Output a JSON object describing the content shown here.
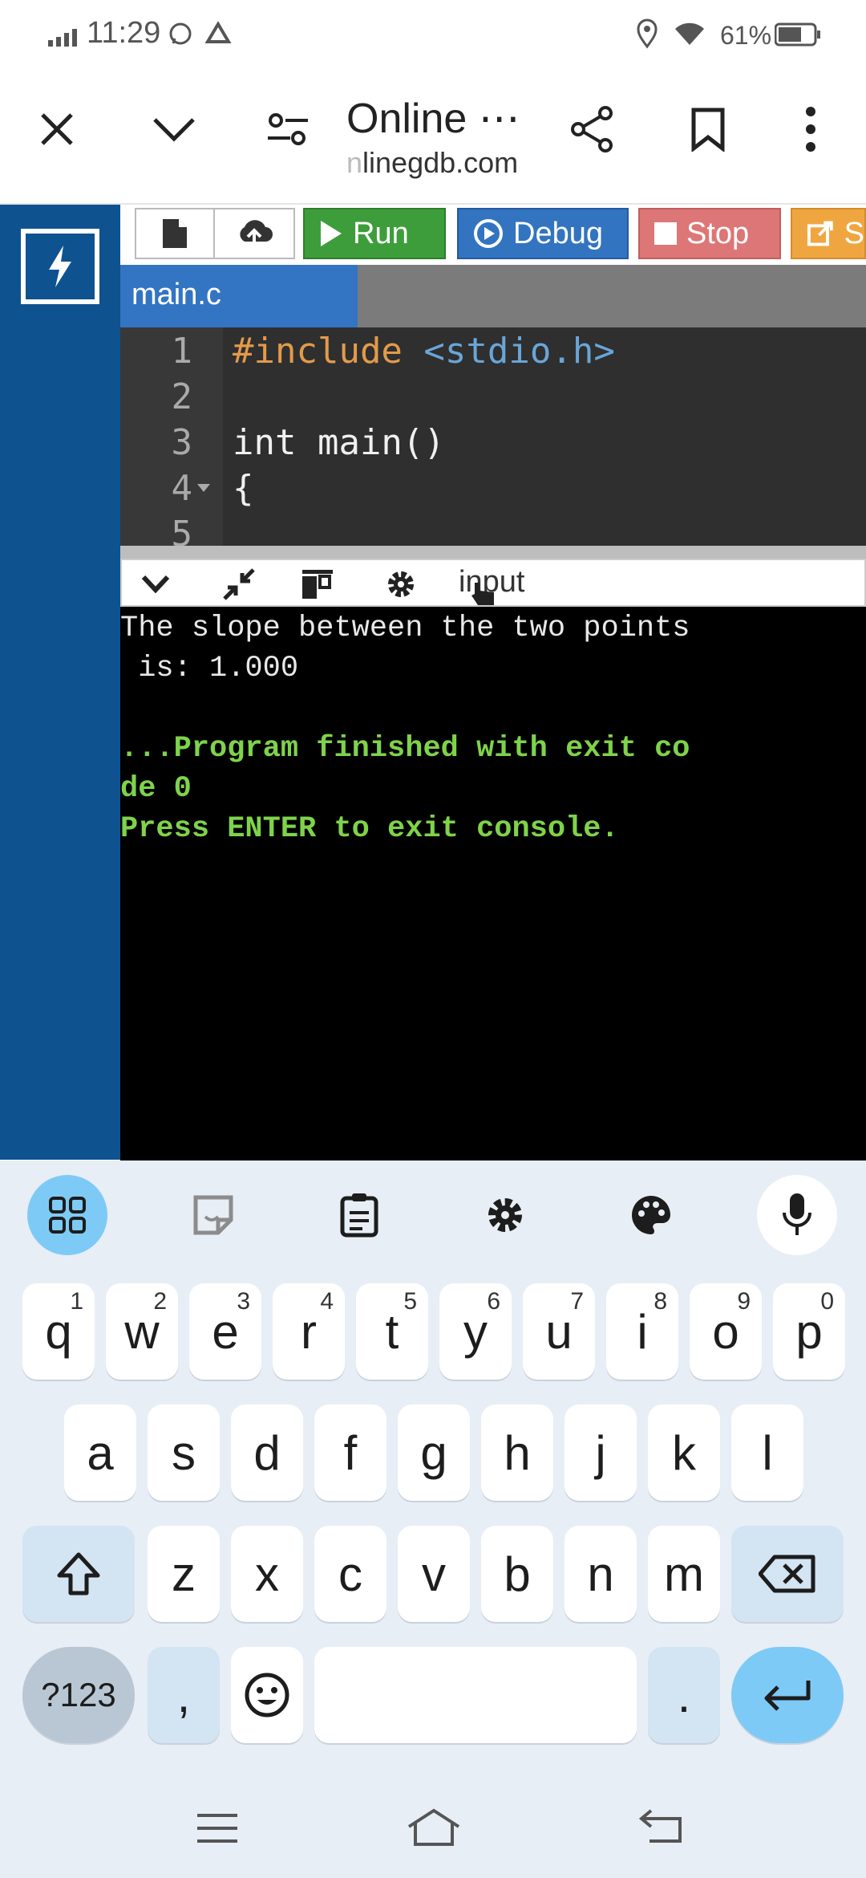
{
  "status_bar": {
    "time": "11:29",
    "battery": "61%"
  },
  "browser": {
    "title": "Online ⋯",
    "url_faded": "n",
    "url": "linegdb.com"
  },
  "toolbar": {
    "run_label": "Run",
    "debug_label": "Debug",
    "stop_label": "Stop",
    "share_label": "S"
  },
  "tabs": [
    {
      "label": "main.c"
    }
  ],
  "editor": {
    "lines": [
      {
        "no": "1",
        "pre": "#include ",
        "inc": "<stdio.h>",
        "text": ""
      },
      {
        "no": "2",
        "pre": "",
        "inc": "",
        "text": ""
      },
      {
        "no": "3",
        "pre": "",
        "inc": "",
        "text": "int main()"
      },
      {
        "no": "4",
        "pre": "",
        "inc": "",
        "text": "{"
      },
      {
        "no": "5",
        "pre": "",
        "inc": "",
        "text": ""
      }
    ]
  },
  "console_toolbar": {
    "label": "input"
  },
  "console": {
    "lines": [
      "The slope between the two points",
      " is: 1.000",
      "",
      "...Program finished with exit co",
      "de 0",
      "Press ENTER to exit console."
    ]
  },
  "keyboard": {
    "row1": [
      {
        "k": "q",
        "s": "1"
      },
      {
        "k": "w",
        "s": "2"
      },
      {
        "k": "e",
        "s": "3"
      },
      {
        "k": "r",
        "s": "4"
      },
      {
        "k": "t",
        "s": "5"
      },
      {
        "k": "y",
        "s": "6"
      },
      {
        "k": "u",
        "s": "7"
      },
      {
        "k": "i",
        "s": "8"
      },
      {
        "k": "o",
        "s": "9"
      },
      {
        "k": "p",
        "s": "0"
      }
    ],
    "row2": [
      "a",
      "s",
      "d",
      "f",
      "g",
      "h",
      "j",
      "k",
      "l"
    ],
    "row3": [
      "z",
      "x",
      "c",
      "v",
      "b",
      "n",
      "m"
    ],
    "symbols_label": "?123",
    "comma": ",",
    "period": "."
  },
  "colors": {
    "rail": "#0f5290",
    "run": "#3e9d3b",
    "debug": "#3274c0",
    "stop": "#dd7676",
    "share": "#f0a640",
    "console_green": "#7ed34a"
  }
}
